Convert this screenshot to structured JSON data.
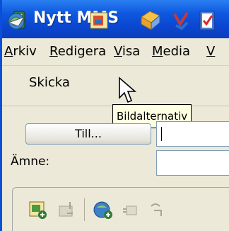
{
  "window": {
    "title": "Nytt MMS",
    "accent": "#0a46cf"
  },
  "menubar": {
    "items": [
      {
        "label": "Arkiv",
        "mnemonic": "A"
      },
      {
        "label": "Redigera",
        "mnemonic": "R"
      },
      {
        "label": "Visa",
        "mnemonic": "V"
      },
      {
        "label": "Media",
        "mnemonic": "M"
      },
      {
        "label": "V",
        "mnemonic": "V"
      }
    ]
  },
  "toolbar": {
    "send_label": "Skicka",
    "icons": [
      "send-icon",
      "image-options-icon",
      "attach-icon",
      "spellcheck-icon",
      "check-icon"
    ]
  },
  "tooltip": {
    "text": "Bildalternativ"
  },
  "form": {
    "to_button": "Till...",
    "to_value": "",
    "subject_label": "Ämne:",
    "subject_value": ""
  },
  "editor_toolbar": {
    "icons": [
      "insert-image-icon",
      "insert-image-disabled-icon",
      "insert-sound-icon",
      "slide-add-icon",
      "slide-remove-icon"
    ]
  }
}
